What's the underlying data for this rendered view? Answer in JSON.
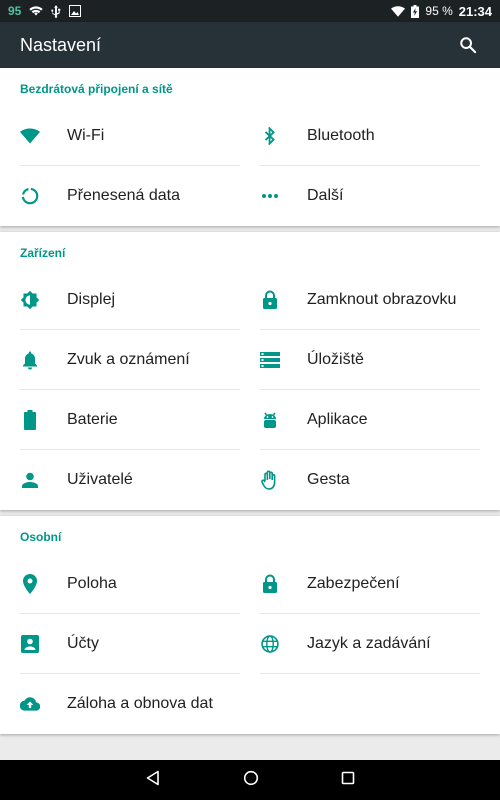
{
  "status_bar": {
    "notification_count": "95",
    "battery_percent": "95 %",
    "time": "21:34",
    "icons": [
      "wifi-icon",
      "usb-icon",
      "image-icon",
      "signal-icon",
      "battery-icon"
    ]
  },
  "app_bar": {
    "title": "Nastavení",
    "search_icon": "search-icon"
  },
  "accent_color": "#009688",
  "sections": [
    {
      "title": "Bezdrátová připojení a sítě",
      "items": [
        {
          "label": "Wi-Fi",
          "icon": "wifi-icon"
        },
        {
          "label": "Bluetooth",
          "icon": "bluetooth-icon"
        },
        {
          "label": "Přenesená data",
          "icon": "data-usage-icon"
        },
        {
          "label": "Další",
          "icon": "more-icon"
        }
      ]
    },
    {
      "title": "Zařízení",
      "items": [
        {
          "label": "Displej",
          "icon": "brightness-icon"
        },
        {
          "label": "Zamknout obrazovku",
          "icon": "lock-icon"
        },
        {
          "label": "Zvuk a oznámení",
          "icon": "bell-icon"
        },
        {
          "label": "Úložiště",
          "icon": "storage-icon"
        },
        {
          "label": "Baterie",
          "icon": "battery-icon"
        },
        {
          "label": "Aplikace",
          "icon": "android-icon"
        },
        {
          "label": "Uživatelé",
          "icon": "person-icon"
        },
        {
          "label": "Gesta",
          "icon": "hand-icon"
        }
      ]
    },
    {
      "title": "Osobní",
      "items": [
        {
          "label": "Poloha",
          "icon": "location-icon"
        },
        {
          "label": "Zabezpečení",
          "icon": "lock-icon"
        },
        {
          "label": "Účty",
          "icon": "account-box-icon"
        },
        {
          "label": "Jazyk a zadávání",
          "icon": "globe-icon"
        },
        {
          "label": "Záloha a obnova dat",
          "icon": "cloud-upload-icon"
        }
      ]
    }
  ],
  "nav_bar": {
    "icons": [
      "back-icon",
      "home-icon",
      "recents-icon"
    ]
  }
}
